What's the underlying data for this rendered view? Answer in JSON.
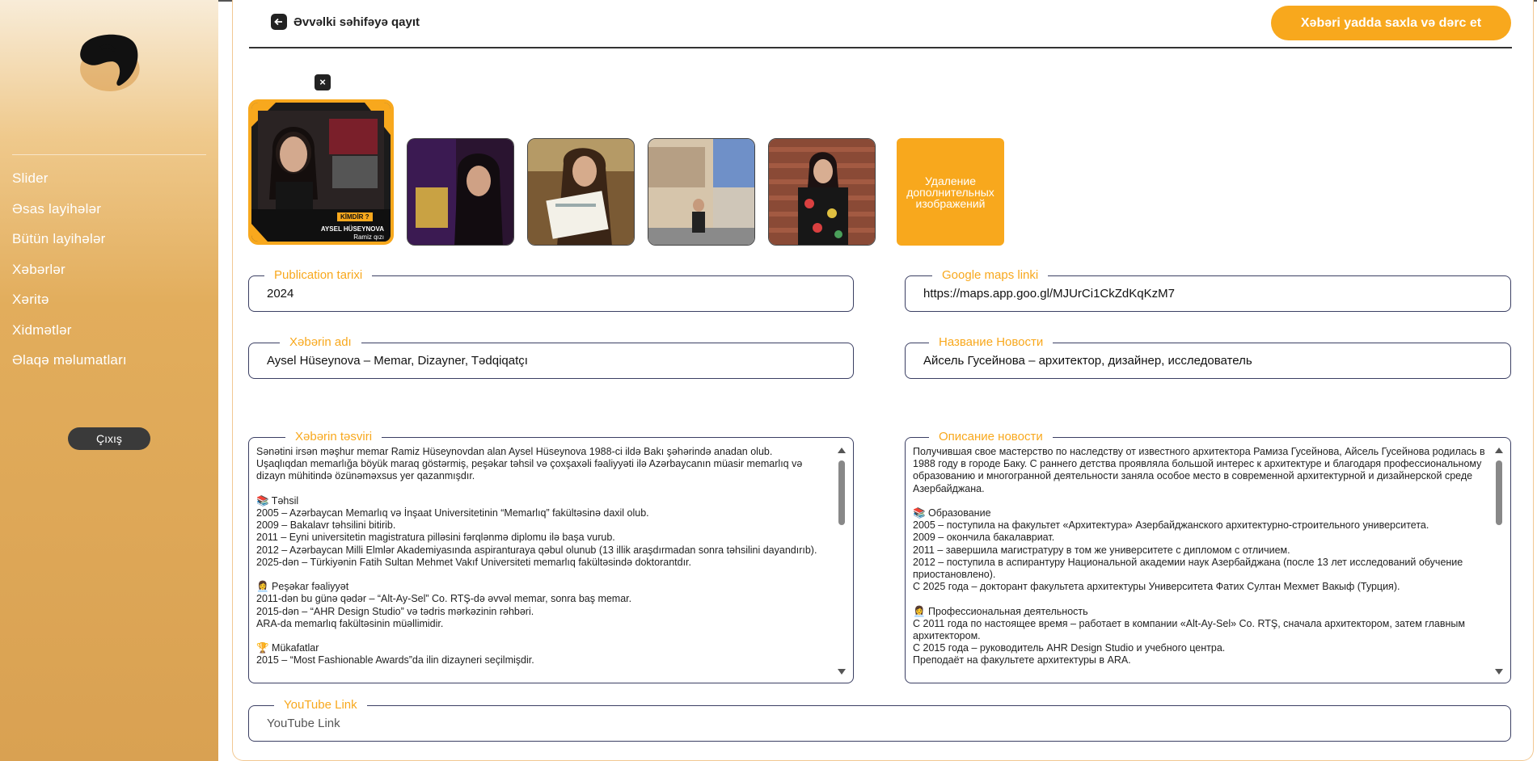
{
  "sidebar": {
    "items": [
      {
        "label": "Slider"
      },
      {
        "label": "Əsas layihələr"
      },
      {
        "label": "Bütün layihələr"
      },
      {
        "label": "Xəbərlər"
      },
      {
        "label": "Xəritə"
      },
      {
        "label": "Xidmətlər"
      },
      {
        "label": "Əlaqə məlumatları"
      }
    ],
    "logout_label": "Çıxış"
  },
  "header": {
    "back_label": "Əvvəlki səhifəyə qayıt",
    "save_label": "Xəbəri yadda saxla və dərc et"
  },
  "images": {
    "remove_symbol": "×",
    "delete_extra_label": "Удаление дополнительных изображений",
    "main_caption_tag": "KİMDİR ?",
    "main_caption_name": "AYSEL HÜSEYNOVA",
    "main_caption_sub": "Ramiz qızı"
  },
  "form": {
    "publication": {
      "legend": "Publication tarixi",
      "value": "2024"
    },
    "maps": {
      "legend": "Google maps linki",
      "value": "https://maps.app.goo.gl/MJUrCi1CkZdKqKzM7"
    },
    "title_az": {
      "legend": "Xəbərin adı",
      "value": "Aysel Hüseynova – Memar, Dizayner, Tədqiqatçı"
    },
    "title_ru": {
      "legend": "Название Новости",
      "value": "Айсель Гусейнова – архитектор, дизайнер, исследователь"
    },
    "desc_az": {
      "legend": "Xəbərin təsviri",
      "value": "Sənətini irsən məşhur memar Ramiz Hüseynovdan alan Aysel Hüseynova 1988-ci ildə Bakı şəhərində anadan olub.\nUşaqlıqdan memarlığa böyük maraq göstərmiş, peşəkar təhsil və çoxşaxəli fəaliyyəti ilə Azərbaycanın müasir memarlıq və dizayn mühitində özünəməxsus yer qazanmışdır.\n\n📚 Təhsil\n2005 – Azərbaycan Memarlıq və İnşaat Universitetinin “Memarlıq” fakültəsinə daxil olub.\n2009 – Bakalavr təhsilini bitirib.\n2011 – Eyni universitetin magistratura pilləsini fərqlənmə diplomu ilə başa vurub.\n2012 – Azərbaycan Milli Elmlər Akademiyasında aspiranturaya qəbul olunub (13 illik araşdırmadan sonra təhsilini dayandırıb).\n2025-dən – Türkiyənin Fatih Sultan Mehmet Vakıf Universiteti memarlıq fakültəsində doktorantdır.\n\n👩‍💼 Peşəkar fəaliyyət\n2011-dən bu günə qədər – “Alt-Ay-Sel” Co. RTŞ-də əvvəl memar, sonra baş memar.\n2015-dən – “AHR Design Studio” və tədris mərkəzinin rəhbəri.\nARA-da memarlıq fakültəsinin müəllimidir.\n\n🏆 Mükafatlar\n2015 – “Most Fashionable Awards”da ilin dizayneri seçilmişdir."
    },
    "desc_ru": {
      "legend": "Описание новости",
      "value": "Получившая свое мастерство по наследству от известного архитектора Рамиза Гусейнова, Айсель Гусейнова родилась в 1988 году в городе Баку. С раннего детства проявляла большой интерес к архитектуре и благодаря профессиональному образованию и многогранной деятельности заняла особое место в современной архитектурной и дизайнерской среде Азербайджана.\n\n📚 Образование\n2005 – поступила на факультет «Архитектура» Азербайджанского архитектурно-строительного университета.\n2009 – окончила бакалавриат.\n2011 – завершила магистратуру в том же университете с дипломом с отличием.\n2012 – поступила в аспирантуру Национальной академии наук Азербайджана (после 13 лет исследований обучение приостановлено).\nС 2025 года – докторант факультета архитектуры Университета Фатих Султан Мехмет Вакыф (Турция).\n\n👩‍💼 Профессиональная деятельность\nС 2011 года по настоящее время – работает в компании «Alt-Ay-Sel» Co. RTŞ, сначала архитектором, затем главным архитектором.\nС 2015 года – руководитель AHR Design Studio и учебного центра.\nПреподаёт на факультете архитектуры в ARA."
    },
    "youtube": {
      "legend": "YouTube Link",
      "placeholder": "YouTube Link"
    }
  },
  "colors": {
    "accent": "#f8a81d",
    "dark": "#222222",
    "border": "#3b3f63"
  }
}
